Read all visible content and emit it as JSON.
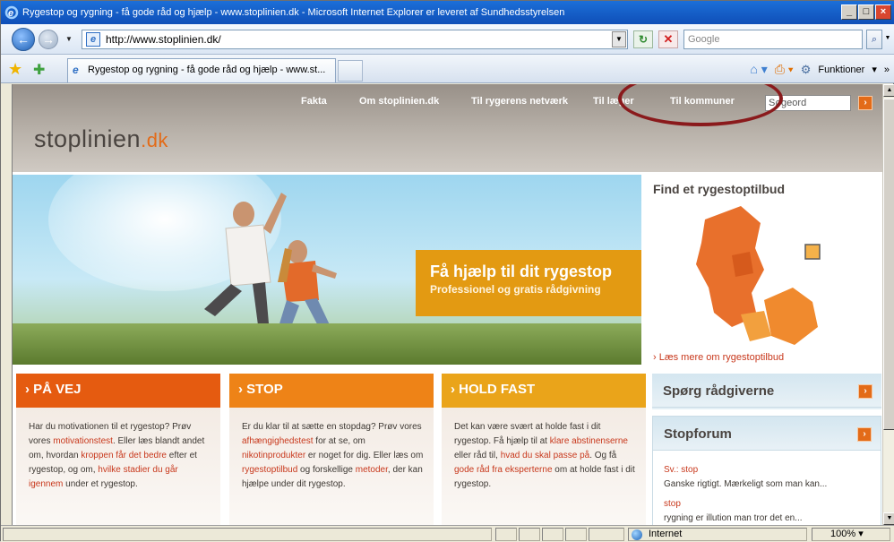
{
  "window": {
    "title": "Rygestop og rygning - få gode råd og hjælp - www.stoplinien.dk - Microsoft Internet Explorer er leveret af Sundhedsstyrelsen",
    "controls": [
      "_",
      "□",
      "×"
    ]
  },
  "address_bar": {
    "url": "http://www.stoplinien.dk/",
    "search_placeholder": "Google"
  },
  "tab": {
    "title": "Rygestop og rygning - få gode råd og hjælp - www.st..."
  },
  "command_bar": {
    "tools_label": "Funktioner"
  },
  "site": {
    "logo_main": "stoplinien",
    "logo_suffix": ".dk",
    "nav": [
      "Fakta",
      "Om stoplinien.dk",
      "Til rygerens netværk",
      "Til læger",
      "Til kommuner"
    ],
    "search_placeholder": "Søgeord",
    "hero_heading": "Få hjælp til dit rygestop",
    "hero_subheading": "Professionel og gratis rådgivning",
    "map_title": "Find et rygestoptilbud",
    "map_link": "› Læs mere om rygestoptilbud",
    "columns": [
      {
        "title": "› PÅ VEJ",
        "t1": "Har du motivationen til et rygestop? Prøv vores ",
        "l1": "motivationstest",
        "t2": ". Eller læs blandt andet om, hvordan ",
        "l2": "kroppen får det bedre",
        "t3": " efter et rygestop, og om, ",
        "l3": "hvilke stadier du går igennem",
        "t4": " under et rygestop."
      },
      {
        "title": "› STOP",
        "t1": "Er du klar til at sætte en stopdag? Prøv vores ",
        "l1": "afhængighedstest",
        "t2": " for at se, om ",
        "l2": "nikotinprodukter",
        "t3": " er noget for dig. Eller læs om ",
        "l3": "rygestoptilbud",
        "t4": " og forskellige ",
        "l4": "metoder",
        "t5": ", der kan hjælpe under dit rygestop."
      },
      {
        "title": "› HOLD FAST",
        "t1": "Det kan være svært at holde fast i dit rygestop. Få hjælp til at ",
        "l1": "klare abstinenserne",
        "t2": " eller råd til, ",
        "l2": "hvad du skal passe på",
        "t3": ". Og få ",
        "l3": "gode råd fra eksperterne",
        "t4": " om at holde fast i dit rygestop."
      }
    ],
    "ask_title": "Spørg rådgiverne",
    "forum_title": "Stopforum",
    "forum_posts": [
      {
        "title": "Sv.: stop",
        "excerpt": "Ganske rigtigt. Mærkeligt som man kan..."
      },
      {
        "title": "stop",
        "excerpt": "rygning er illution man tror det en..."
      }
    ]
  },
  "status_bar": {
    "zone": "Internet",
    "zoom": "100%"
  },
  "colors": {
    "accent_orange": "#e36b18",
    "annotation_circle": "#8a1a1c"
  }
}
